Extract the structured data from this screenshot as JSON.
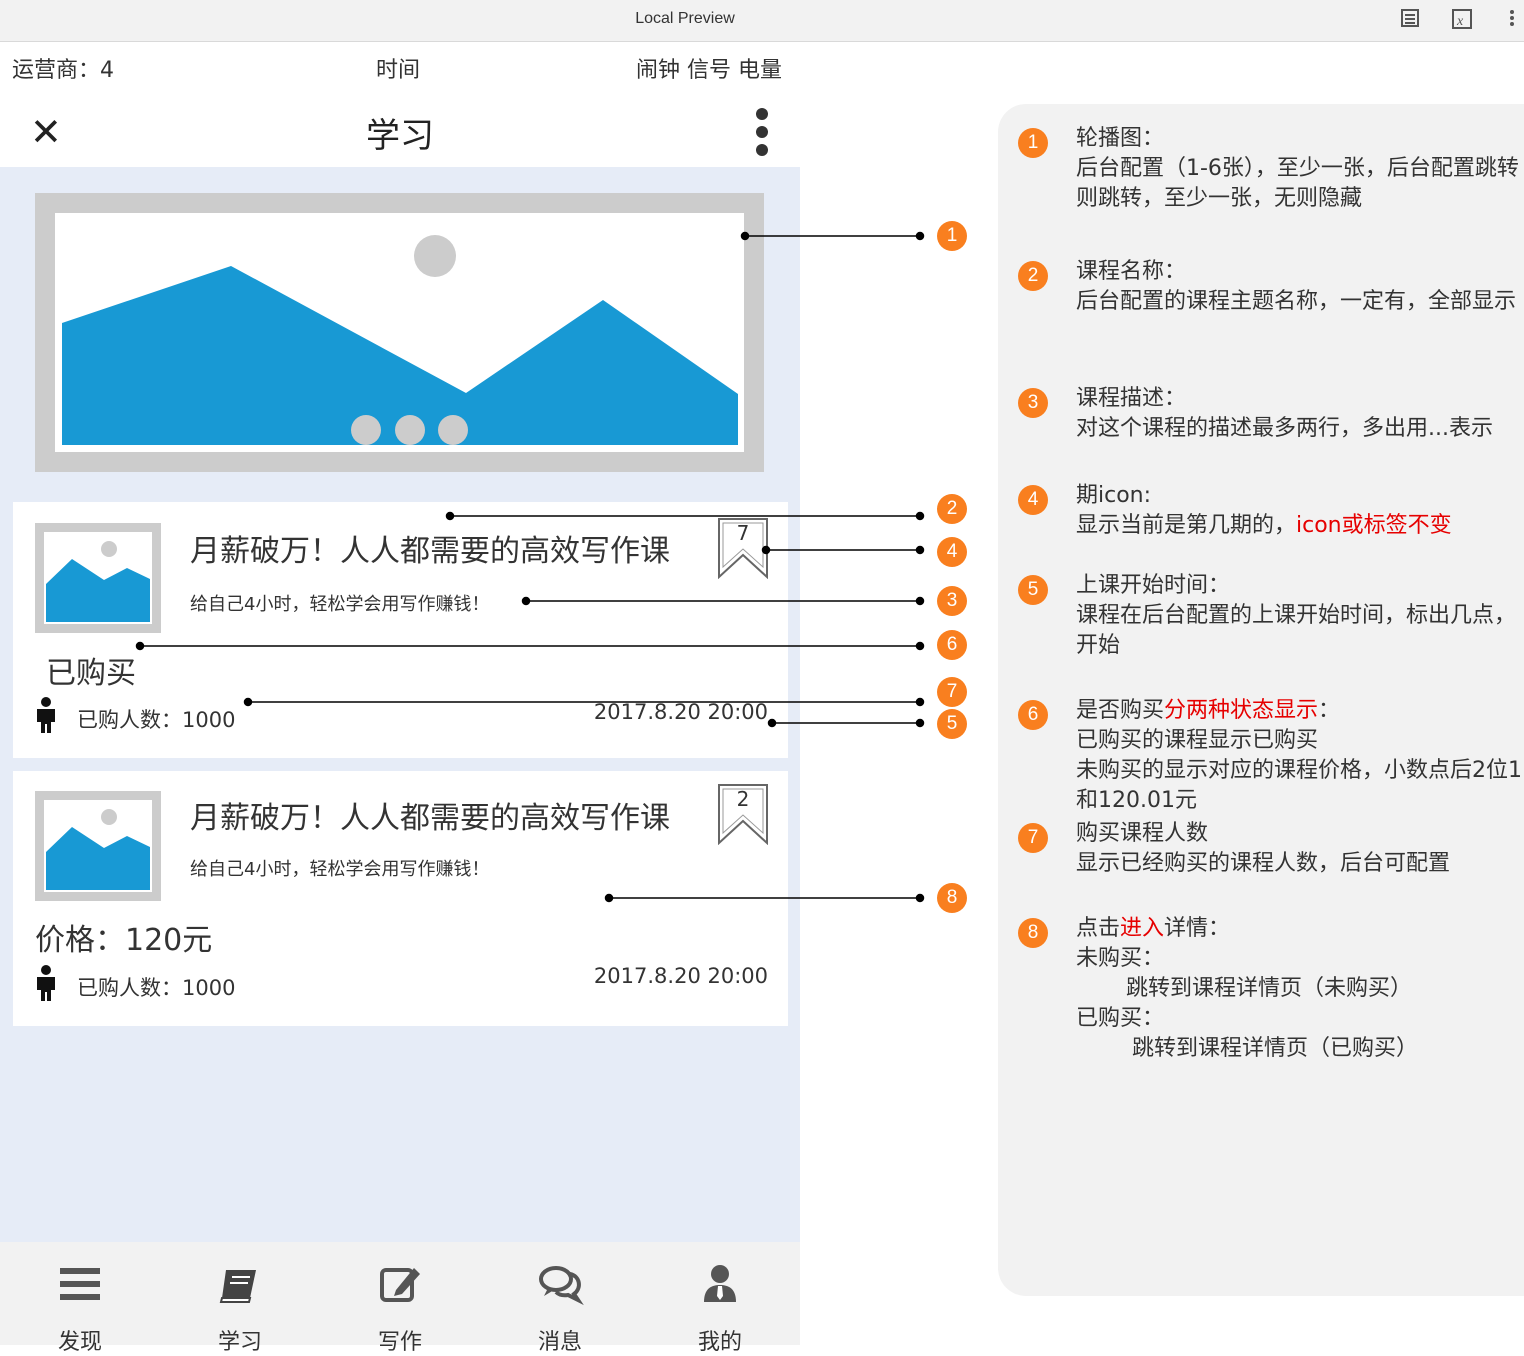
{
  "browser": {
    "title": "Local Preview"
  },
  "status_bar": {
    "carrier": "运营商：4",
    "time": "时间",
    "right": "闹钟 信号 电量"
  },
  "navbar": {
    "title": "学习"
  },
  "courses": [
    {
      "title": "月薪破万！人人都需要的高效写作课",
      "desc": "给自己4小时，轻松学会用写作赚钱！",
      "period": "7",
      "state": "已购买",
      "buyers": "已购人数：1000",
      "date": "2017.8.20 20:00"
    },
    {
      "title": "月薪破万！人人都需要的高效写作课",
      "desc": "给自己4小时，轻松学会用写作赚钱！",
      "period": "2",
      "state": "价格：120元",
      "buyers": "已购人数：1000",
      "date": "2017.8.20 20:00"
    }
  ],
  "tabs": [
    {
      "label": "发现",
      "icon": "menu-icon"
    },
    {
      "label": "学习",
      "icon": "book-icon"
    },
    {
      "label": "写作",
      "icon": "edit-icon"
    },
    {
      "label": "消息",
      "icon": "chat-icon"
    },
    {
      "label": "我的",
      "icon": "user-icon"
    }
  ],
  "annotation_badges": [
    "1",
    "2",
    "4",
    "3",
    "6",
    "7",
    "5",
    "8"
  ],
  "notes": [
    {
      "num": "1",
      "lines": [
        "轮播图：",
        "后台配置（1-6张），至少一张，后台配置跳转",
        "则跳转，至少一张，无则隐藏"
      ]
    },
    {
      "num": "2",
      "lines": [
        "课程名称：",
        "后台配置的课程主题名称，一定有，全部显示"
      ]
    },
    {
      "num": "3",
      "lines": [
        "课程描述：",
        "对这个课程的描述最多两行，多出用...表示"
      ]
    },
    {
      "num": "4",
      "title": "期icon:",
      "line2_a": "显示当前是第几期的，",
      "line2_b": "icon或标签不变"
    },
    {
      "num": "5",
      "lines": [
        "上课开始时间：",
        "课程在后台配置的上课开始时间，标出几点，",
        "开始"
      ]
    },
    {
      "num": "6",
      "title_a": "是否购买",
      "title_b": "分两种状态显示",
      "title_c": "：",
      "lines": [
        "已购买的课程显示已购买",
        "未购买的显示对应的课程价格，小数点后2位1",
        "和120.01元"
      ]
    },
    {
      "num": "7",
      "lines": [
        "购买课程人数",
        "显示已经购买的课程人数，后台可配置"
      ]
    },
    {
      "num": "8",
      "title_a": "点击",
      "title_b": "进入",
      "title_c": "详情：",
      "lines": [
        "未购买：",
        "跳转到课程详情页（未购买）",
        "已购买：",
        "跳转到课程详情页（已购买）"
      ]
    }
  ],
  "colors": {
    "accent": "#f97f1f",
    "image_blue": "#1899d4",
    "highlight": "#e60000",
    "bg": "#e6ecf7"
  }
}
